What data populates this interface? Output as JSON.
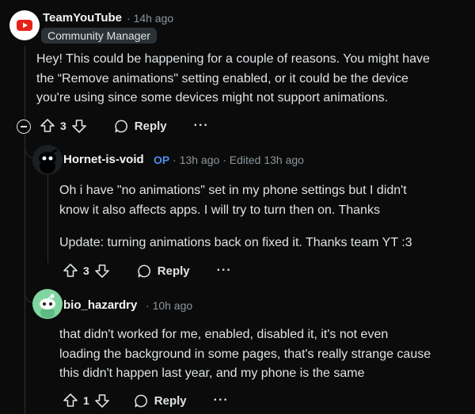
{
  "comments": [
    {
      "author": "TeamYouTube",
      "time": "14h ago",
      "flair": "Community Manager",
      "lines": [
        "Hey! This could be happening for a couple of reasons. You might have",
        "the “Remove animations\" setting enabled, or it could be the device",
        "you're using since some devices might not support animations."
      ],
      "votes": "3",
      "reply_label": "Reply",
      "more_label": "···"
    },
    {
      "author": "Hornet-is-void",
      "op_badge": "OP",
      "time": "13h ago",
      "edited": "Edited 13h ago",
      "lines": [
        "Oh i have \"no animations\" set in my phone settings but I didn't",
        "know it also affects apps. I will try to turn then on. Thanks",
        "Update: turning animations back on fixed it. Thanks team YT :3"
      ],
      "votes": "3",
      "reply_label": "Reply",
      "more_label": "···"
    },
    {
      "author": "bio_hazardry",
      "time": "10h ago",
      "lines": [
        "that didn't worked for me, enabled, disabled it, it's not even",
        "loading the background in some pages, that's really strange cause",
        "this didn't happen last year, and my phone is the same"
      ],
      "votes": "1",
      "reply_label": "Reply",
      "more_label": "···"
    }
  ],
  "colors": {
    "background": "#0b0b0b",
    "youtube_red": "#e62117",
    "op_blue": "#4e8ee8",
    "avatar_green": "#7fd6a0"
  },
  "icons": {
    "upvote": "upvote-arrow-icon",
    "downvote": "downvote-arrow-icon",
    "reply": "speech-bubble-icon",
    "collapse": "collapse-minus-icon"
  }
}
